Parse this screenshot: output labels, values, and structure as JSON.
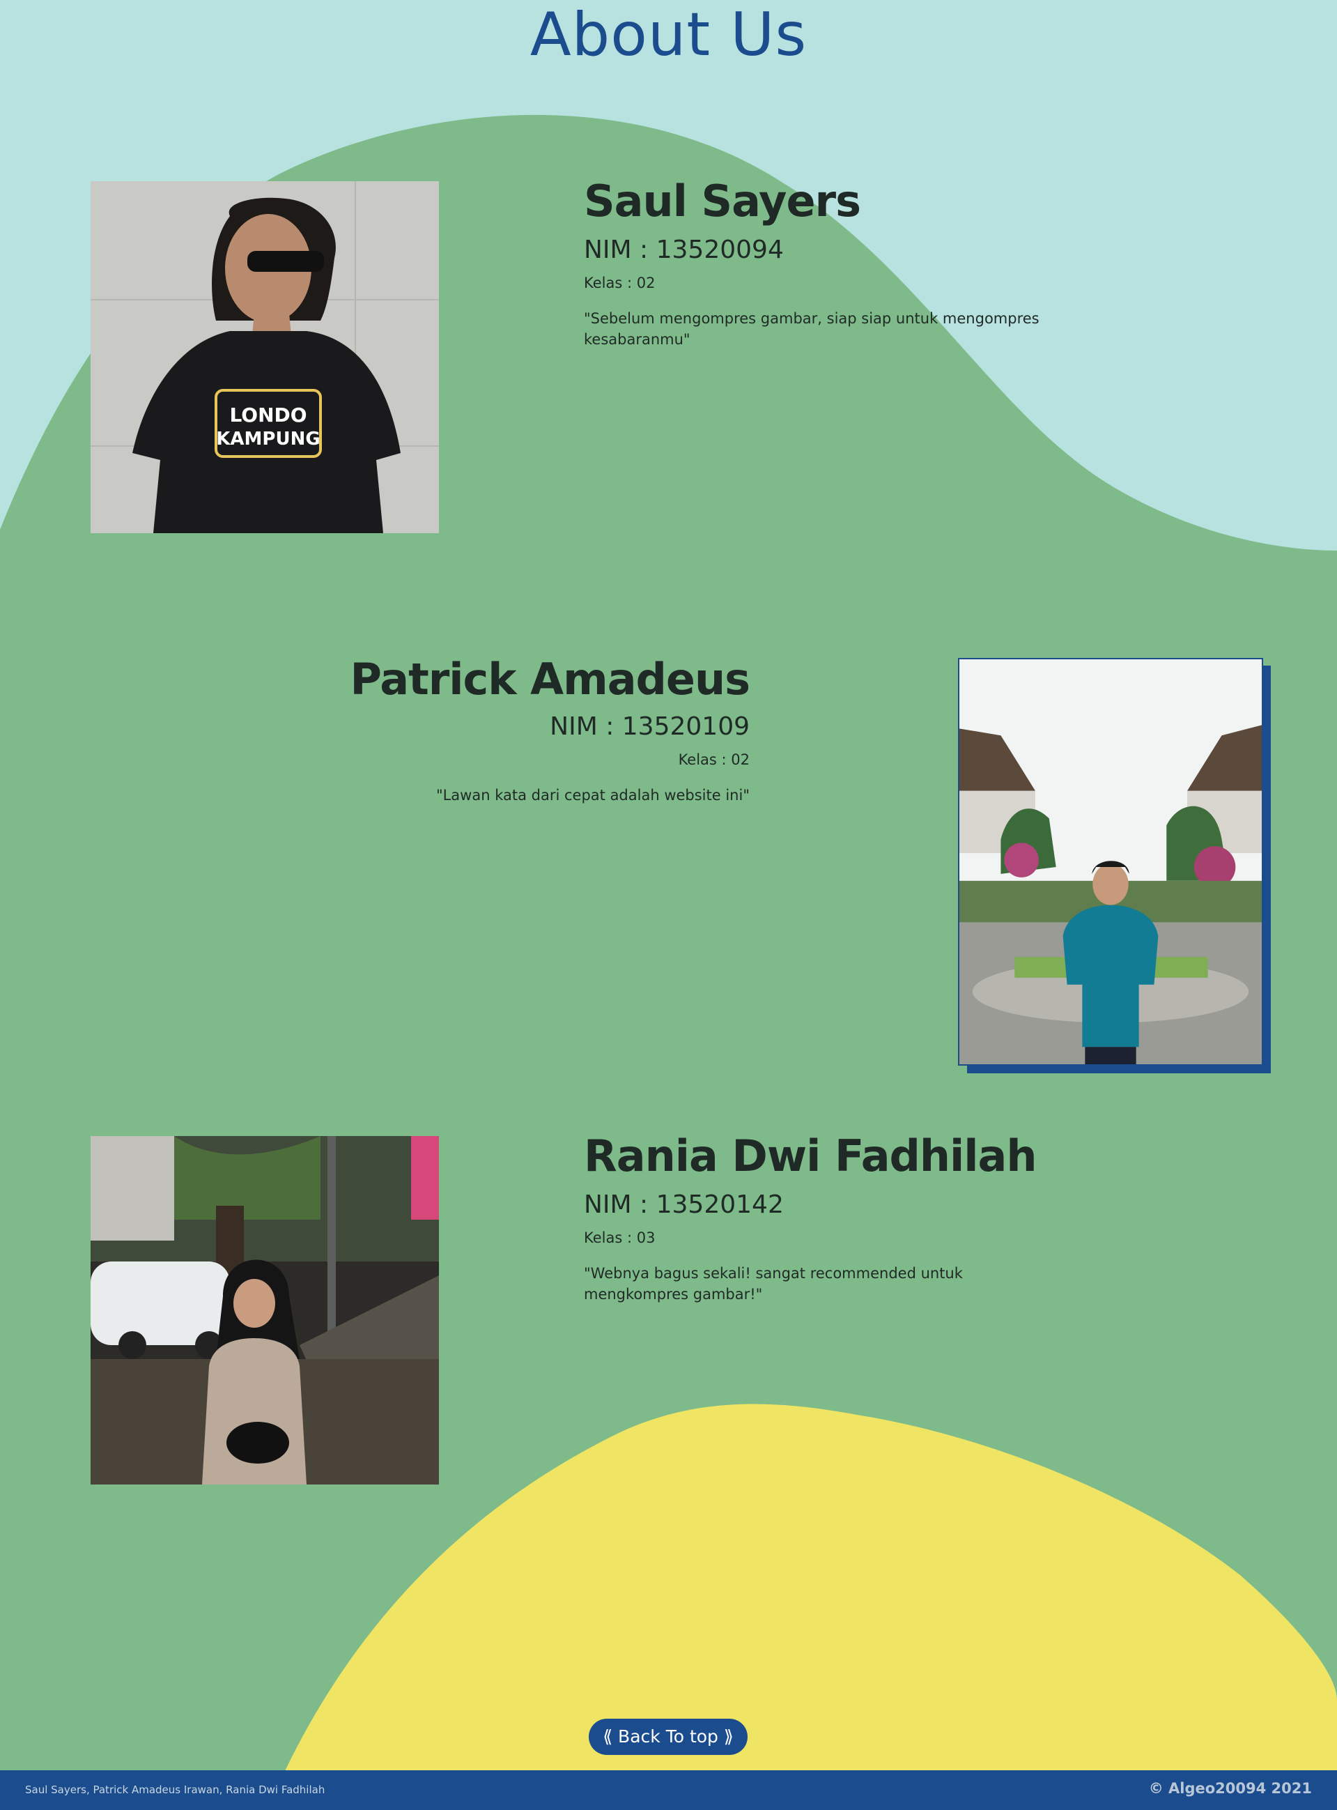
{
  "page": {
    "title": "About Us",
    "colors": {
      "background": "#b8e2df",
      "green_blob": "#7fbb8a",
      "yellow_blob": "#f0e465",
      "accent_blue": "#1b4d8e",
      "text": "#1f2a26"
    }
  },
  "members": [
    {
      "name": "Saul Sayers",
      "nim": "NIM : 13520094",
      "kelas": "Kelas : 02",
      "quote": "\"Sebelum mengompres gambar, siap siap untuk mengompres kesabaranmu\"",
      "photo_icon": "portrait-photo",
      "shirt_text_line1": "LONDO",
      "shirt_text_line2": "KAMPUNG"
    },
    {
      "name": "Patrick Amadeus",
      "nim": "NIM : 13520109",
      "kelas": "Kelas : 02",
      "quote": "\"Lawan kata dari cepat adalah website ini\"",
      "photo_icon": "portrait-photo"
    },
    {
      "name": "Rania Dwi Fadhilah",
      "nim": "NIM : 13520142",
      "kelas": "Kelas : 03",
      "quote": "\"Webnya bagus sekali! sangat recommended untuk mengkompres gambar!\"",
      "photo_icon": "portrait-photo"
    }
  ],
  "back_to_top": {
    "label": "⟪ Back To top ⟫"
  },
  "footer": {
    "names": "Saul Sayers, Patrick Amadeus Irawan, Rania Dwi Fadhilah",
    "copyright": "© Algeo20094 2021"
  }
}
